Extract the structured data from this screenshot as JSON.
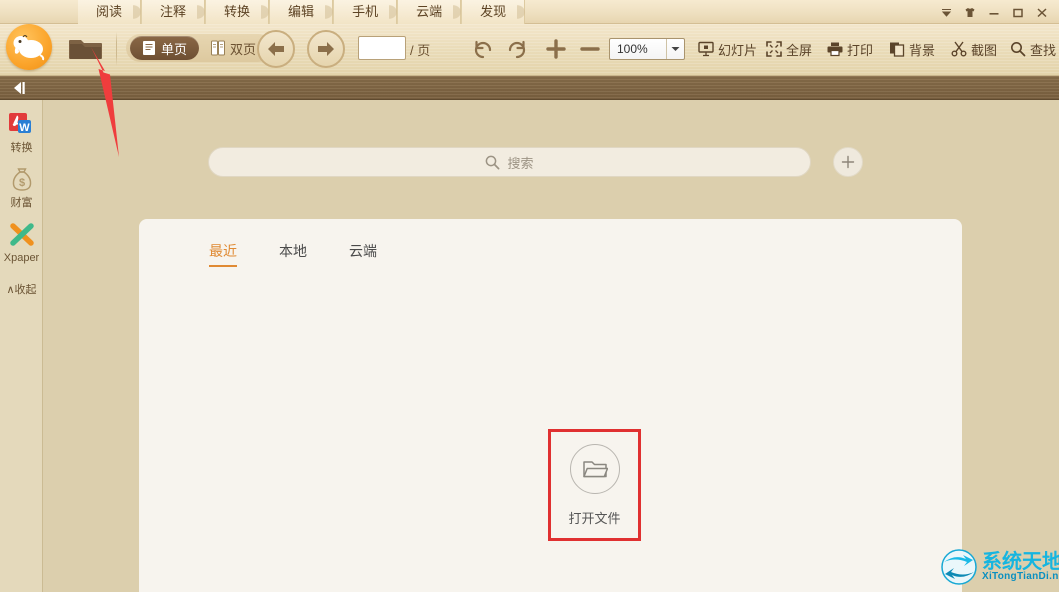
{
  "window": {
    "tabs": [
      {
        "label": "阅读",
        "name": "tab-read"
      },
      {
        "label": "注释",
        "name": "tab-annotate"
      },
      {
        "label": "转换",
        "name": "tab-convert"
      },
      {
        "label": "编辑",
        "name": "tab-edit"
      },
      {
        "label": "手机",
        "name": "tab-mobile"
      },
      {
        "label": "云端",
        "name": "tab-cloud"
      },
      {
        "label": "发现",
        "name": "tab-discover"
      }
    ],
    "controls": [
      {
        "name": "dropdown-menu-icon",
        "glyph": "▼"
      },
      {
        "name": "skin-icon",
        "glyph": "♦"
      },
      {
        "name": "minimize-icon",
        "glyph": "—"
      },
      {
        "name": "maximize-icon",
        "glyph": "▢"
      },
      {
        "name": "close-icon",
        "glyph": "✕"
      }
    ]
  },
  "toolbar": {
    "logo_name": "app-logo",
    "open_folder_name": "open-folder-icon",
    "page_mode": {
      "single": "单页",
      "double": "双页",
      "active": "单页"
    },
    "prev_label": "上一页",
    "next_label": "下一页",
    "page_input_value": "",
    "page_input_placeholder": "",
    "page_suffix": "/ 页",
    "rotate_left_name": "rotate-left-icon",
    "rotate_right_name": "rotate-right-icon",
    "zoom_in_name": "zoom-in-icon",
    "zoom_out_name": "zoom-out-icon",
    "zoom_value": "100%",
    "items": [
      {
        "label": "幻灯片",
        "name": "slideshow-button"
      },
      {
        "label": "全屏",
        "name": "fullscreen-button"
      },
      {
        "label": "打印",
        "name": "print-button"
      },
      {
        "label": "背景",
        "name": "background-button"
      },
      {
        "label": "截图",
        "name": "screenshot-button"
      },
      {
        "label": "查找",
        "name": "find-button"
      }
    ]
  },
  "strip": {
    "collapse_name": "collapse-panel-icon"
  },
  "sidebar": {
    "items": [
      {
        "label": "转换",
        "name": "sidebar-item-convert",
        "icon": "pdf-to-word-icon"
      },
      {
        "label": "财富",
        "name": "sidebar-item-wealth",
        "icon": "money-bag-icon"
      },
      {
        "label": "Xpaper",
        "name": "sidebar-item-xpaper",
        "icon": "xpaper-icon"
      }
    ],
    "collapse_label": "∧收起"
  },
  "main": {
    "search": {
      "placeholder": "搜索",
      "value": ""
    },
    "add_label": "+",
    "tabs": [
      {
        "label": "最近",
        "name": "tab-recent",
        "active": true
      },
      {
        "label": "本地",
        "name": "tab-local",
        "active": false
      },
      {
        "label": "云端",
        "name": "tab-cloud-files",
        "active": false
      }
    ],
    "open_file": {
      "label": "打开文件",
      "icon": "folder-open-icon"
    }
  },
  "annotation": {
    "arrow_name": "red-arrow-annotation",
    "highlight_name": "red-highlight-box",
    "color": "#e03030"
  },
  "watermark": {
    "cn": "系统天地",
    "en": "XiTongTianDi.net",
    "logo_name": "watermark-globe-icon",
    "color": "#16b5e0"
  },
  "colors": {
    "background": "#dccfad",
    "toolbar": "#eadcb9",
    "panel": "#f7f4ee",
    "accent": "#e08a33",
    "strip": "#7c6241"
  }
}
